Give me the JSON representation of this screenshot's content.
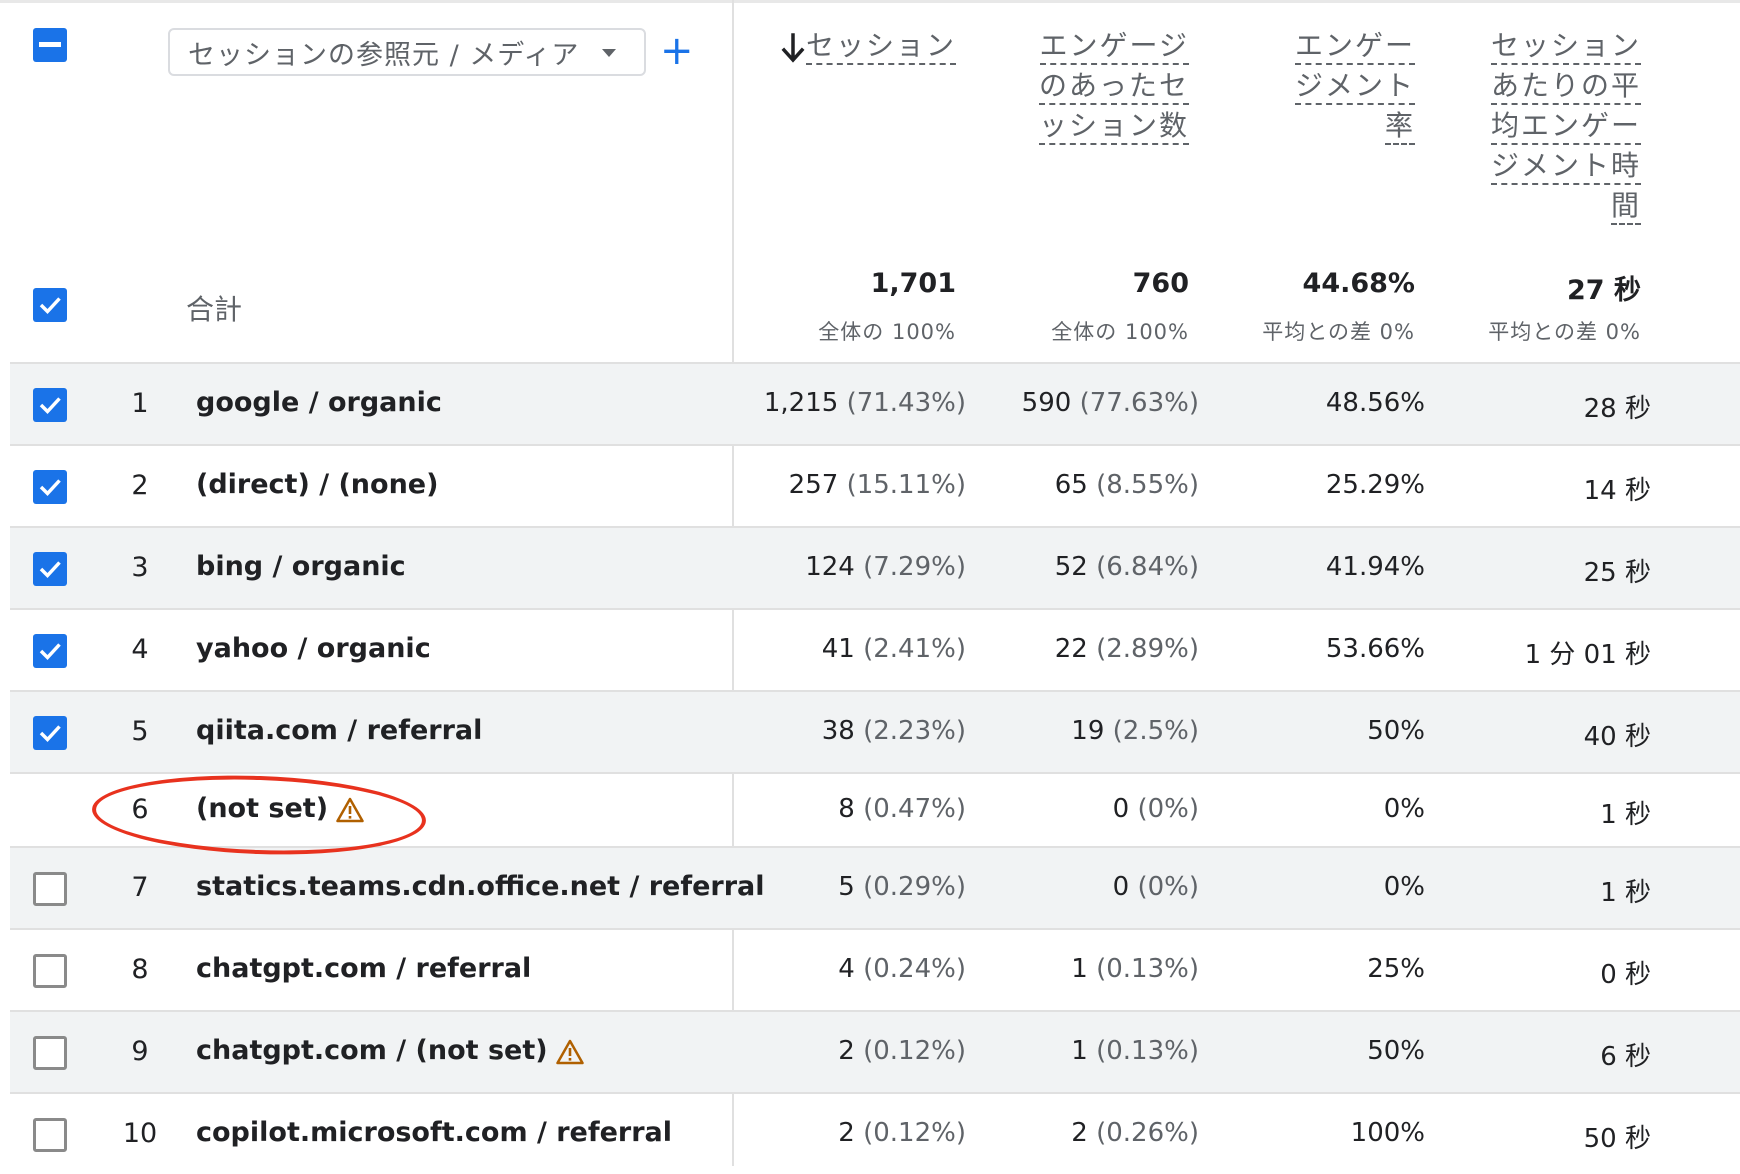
{
  "dimension": {
    "label": "セッションの参照元 / メディア",
    "add_label": "+"
  },
  "headers": [
    [
      "セッション"
    ],
    [
      "エンゲージ",
      "のあったセ",
      "ッション数"
    ],
    [
      "エンゲー",
      "ジメント",
      "率"
    ],
    [
      "セッション",
      "あたりの平",
      "均エンゲー",
      "ジメント時",
      "間"
    ]
  ],
  "totals": {
    "label": "合計",
    "values": [
      "1,701",
      "760",
      "44.68%",
      "27 秒"
    ],
    "subs": [
      "全体の 100%",
      "全体の 100%",
      "平均との差 0%",
      "平均との差 0%"
    ]
  },
  "rows": [
    {
      "num": "1",
      "name": "google / organic",
      "c1": "1,215",
      "p1": "(71.43%)",
      "c2": "590",
      "p2": "(77.63%)",
      "c3": "48.56%",
      "c4": "28 秒",
      "checked": true,
      "warn": false
    },
    {
      "num": "2",
      "name": "(direct) / (none)",
      "c1": "257",
      "p1": "(15.11%)",
      "c2": "65",
      "p2": "(8.55%)",
      "c3": "25.29%",
      "c4": "14 秒",
      "checked": true,
      "warn": false
    },
    {
      "num": "3",
      "name": "bing / organic",
      "c1": "124",
      "p1": "(7.29%)",
      "c2": "52",
      "p2": "(6.84%)",
      "c3": "41.94%",
      "c4": "25 秒",
      "checked": true,
      "warn": false
    },
    {
      "num": "4",
      "name": "yahoo / organic",
      "c1": "41",
      "p1": "(2.41%)",
      "c2": "22",
      "p2": "(2.89%)",
      "c3": "53.66%",
      "c4": "1 分 01 秒",
      "checked": true,
      "warn": false
    },
    {
      "num": "5",
      "name": "qiita.com / referral",
      "c1": "38",
      "p1": "(2.23%)",
      "c2": "19",
      "p2": "(2.5%)",
      "c3": "50%",
      "c4": "40 秒",
      "checked": true,
      "warn": false
    },
    {
      "num": "6",
      "name": "(not set)",
      "c1": "8",
      "p1": "(0.47%)",
      "c2": "0",
      "p2": "(0%)",
      "c3": "0%",
      "c4": "1 秒",
      "checked": null,
      "warn": true
    },
    {
      "num": "7",
      "name": "statics.teams.cdn.office.net / referral",
      "c1": "5",
      "p1": "(0.29%)",
      "c2": "0",
      "p2": "(0%)",
      "c3": "0%",
      "c4": "1 秒",
      "checked": false,
      "warn": false
    },
    {
      "num": "8",
      "name": "chatgpt.com / referral",
      "c1": "4",
      "p1": "(0.24%)",
      "c2": "1",
      "p2": "(0.13%)",
      "c3": "25%",
      "c4": "0 秒",
      "checked": false,
      "warn": false
    },
    {
      "num": "9",
      "name": "chatgpt.com / (not set)",
      "c1": "2",
      "p1": "(0.12%)",
      "c2": "1",
      "p2": "(0.13%)",
      "c3": "50%",
      "c4": "6 秒",
      "checked": false,
      "warn": true
    },
    {
      "num": "10",
      "name": "copilot.microsoft.com / referral",
      "c1": "2",
      "p1": "(0.12%)",
      "c2": "2",
      "p2": "(0.26%)",
      "c3": "100%",
      "c4": "50 秒",
      "checked": false,
      "warn": false
    }
  ],
  "colors": {
    "accent": "#1a73e8",
    "row_shaded": "#f1f3f4",
    "warning": "#b06000",
    "annotation_circle": "#e8321e"
  }
}
